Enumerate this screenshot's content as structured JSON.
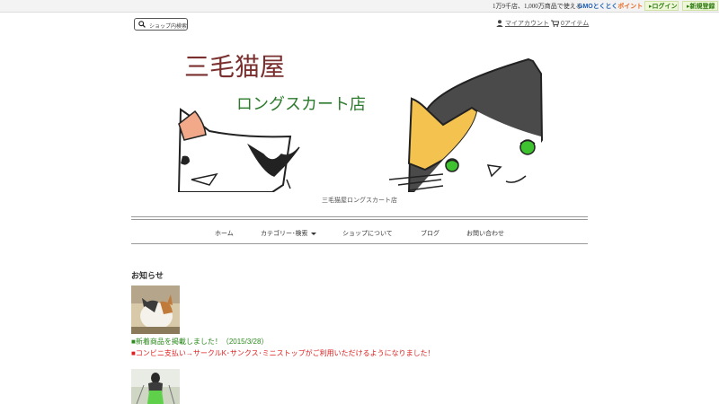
{
  "topbar": {
    "promo": "1万9千店、1,000万商品で使える",
    "gmo_logo_a": "GMOとくとく",
    "gmo_logo_b": "ポイント",
    "login": "ログイン",
    "register": "新規登録"
  },
  "header": {
    "search_label": "ショップ内検索",
    "account_label": "マイアカウント",
    "cart_label": "0アイテム"
  },
  "banner": {
    "title": "三毛猫屋",
    "subtitle": "ロングスカート店"
  },
  "shop_name": "三毛猫屋ロングスカート店",
  "nav": {
    "items": [
      "ホーム",
      "カテゴリー･検索",
      "ショップについて",
      "ブログ",
      "お問い合わせ"
    ]
  },
  "news": {
    "heading": "お知らせ",
    "items": [
      "■新着商品を掲載しました！（2015/3/28）",
      "■コンビニ支払い→サークルK･サンクス･ミニストップがご利用いただけるようになりました！"
    ]
  },
  "colors": {
    "news_green": "#2c8a1e",
    "news_red": "#e02020",
    "banner_title": "#7a2f2f",
    "banner_subtitle": "#2c7a2c"
  }
}
